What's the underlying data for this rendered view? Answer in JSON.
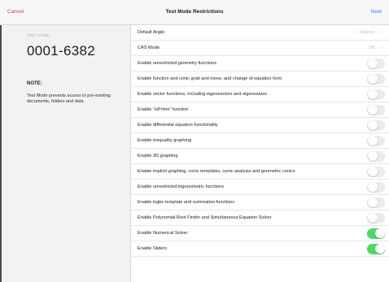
{
  "header": {
    "cancel_label": "Cancel",
    "title": "Test Mode Restrictions",
    "next_label": "Next"
  },
  "left": {
    "test_code_label": "TEST CODE:",
    "test_code": "0001-6382",
    "note_heading": "NOTE:",
    "note_text": "Test Mode prevents access to pre-existing documents, folders and data."
  },
  "settings": [
    {
      "label": "Default Angle",
      "value": "Degree",
      "type": "select"
    },
    {
      "label": "CAS Mode",
      "value": "Off",
      "type": "select"
    },
    {
      "label": "Enable unrestricted geometry functions",
      "type": "toggle",
      "on": false
    },
    {
      "label": "Enable function and conic grab and move, and change of equation form",
      "type": "toggle",
      "on": false
    },
    {
      "label": "Enable vector functions, including eigenvectors and eigenvalues",
      "type": "toggle",
      "on": false
    },
    {
      "label": "Enable “isPrime” function",
      "type": "toggle",
      "on": false
    },
    {
      "label": "Enable differential equation functionality",
      "type": "toggle",
      "on": false
    },
    {
      "label": "Enable inequality graphing",
      "type": "toggle",
      "on": false
    },
    {
      "label": "Enable 3D graphing",
      "type": "toggle",
      "on": false
    },
    {
      "label": "Enable implicit graphing, conic templates, conic analysis and geometric conics",
      "type": "toggle",
      "on": false
    },
    {
      "label": "Enable unrestricted trigonometric functions",
      "type": "toggle",
      "on": false
    },
    {
      "label": "Enable logbx template and summation functions",
      "type": "toggle",
      "on": false
    },
    {
      "label": "Enable Polynomial Root Finder and Simultaneous Equation Solver",
      "type": "toggle",
      "on": false
    },
    {
      "label": "Enable Numerical Solver",
      "type": "toggle",
      "on": true
    },
    {
      "label": "Enable Sliders",
      "type": "toggle",
      "on": true
    }
  ],
  "colors": {
    "cancel": "#e0373b",
    "next": "#2f7cf6",
    "toggle_on": "#4cd964",
    "toggle_off": "#ebebee"
  }
}
